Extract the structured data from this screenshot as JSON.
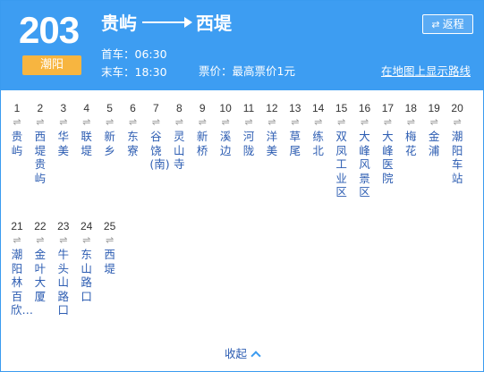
{
  "header": {
    "route_number": "203",
    "city": "潮阳",
    "from": "贵屿",
    "to": "西堤",
    "first_bus": "首车：06:30",
    "last_bus": "末车：18:30",
    "price": "票价：最高票价1元",
    "return_label": "返程",
    "map_link": "在地图上显示路线"
  },
  "stops": [
    {
      "num": "1",
      "name": "贵屿"
    },
    {
      "num": "2",
      "name": "西堤贵屿"
    },
    {
      "num": "3",
      "name": "华美"
    },
    {
      "num": "4",
      "name": "联堤"
    },
    {
      "num": "5",
      "name": "新乡"
    },
    {
      "num": "6",
      "name": "东寮"
    },
    {
      "num": "7",
      "name": "谷饶(南)"
    },
    {
      "num": "8",
      "name": "灵山寺"
    },
    {
      "num": "9",
      "name": "新桥"
    },
    {
      "num": "10",
      "name": "溪边"
    },
    {
      "num": "11",
      "name": "河陇"
    },
    {
      "num": "12",
      "name": "洋美"
    },
    {
      "num": "13",
      "name": "草尾"
    },
    {
      "num": "14",
      "name": "练北"
    },
    {
      "num": "15",
      "name": "双凤工业区"
    },
    {
      "num": "16",
      "name": "大峰风景区"
    },
    {
      "num": "17",
      "name": "大峰医院"
    },
    {
      "num": "18",
      "name": "梅花"
    },
    {
      "num": "19",
      "name": "金浦"
    },
    {
      "num": "20",
      "name": "潮阳车站"
    },
    {
      "num": "21",
      "name": "潮阳林百欣…"
    },
    {
      "num": "22",
      "name": "金叶大厦"
    },
    {
      "num": "23",
      "name": "牛头山路口"
    },
    {
      "num": "24",
      "name": "东山路口"
    },
    {
      "num": "25",
      "name": "西堤"
    }
  ],
  "footer": {
    "collapse_label": "收起"
  }
}
